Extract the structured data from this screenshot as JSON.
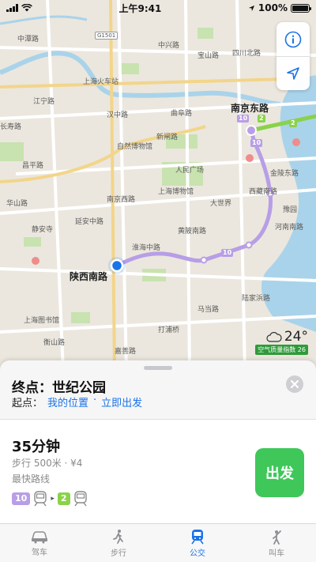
{
  "status_bar": {
    "time": "上午9:41",
    "battery": "100%"
  },
  "map": {
    "labels": {
      "zhongshan": "中潭路",
      "baoshan": "宝山路",
      "zhongxing": "中兴路",
      "sichuan": "四川北路",
      "shanghai_station": "上海火车站",
      "jiangning": "江宁路",
      "hanzhong": "汉中路",
      "qufu": "曲阜路",
      "changshou": "长寿路",
      "nanjing_east": "南京东路",
      "ziran": "自然博物馆",
      "xinzha": "新闸路",
      "changping": "昌平路",
      "people_square": "人民广场",
      "museum": "上海博物馆",
      "nanjing_west": "南京西路",
      "dashijie": "大世界",
      "yanan": "延安中路",
      "jingan": "静安寺",
      "huangpi": "黄陂南路",
      "huaihai": "淮海中路",
      "shaanxi_south": "陕西南路",
      "library": "上海图书馆",
      "madang": "马当路",
      "lujiabang": "陆家浜路",
      "hengshan": "衡山路",
      "dapu": "打浦桥",
      "jiashan": "嘉善路",
      "xizang": "西藏南路",
      "jinling": "金陵东路",
      "yu_garden": "豫园",
      "henan": "河南南路",
      "xinhua": "华山路",
      "south_shaanxi_hwy": "G1501"
    },
    "weather": {
      "temperature": "24°",
      "aqi_label": "空气质量指数 26"
    },
    "line_badges": {
      "line10": "10",
      "line2": "2"
    },
    "colors": {
      "line10": "#b89ee6",
      "line2": "#8ad24a",
      "water": "#a9d3ea",
      "park": "#c8e2b0",
      "road": "#ffffff",
      "location": "#1a73e8"
    }
  },
  "sheet": {
    "destination": "终点：世纪公园",
    "origin_label": "起点：",
    "origin_location": "我的位置",
    "origin_separator": "·",
    "origin_time": "立即出发"
  },
  "route": {
    "duration": "35分钟",
    "meta": "步行 500米 · ¥4",
    "tag": "最快路线",
    "line_a": "10",
    "line_b": "2",
    "go_label": "出发"
  },
  "tabs": [
    {
      "label": "驾车",
      "icon": "car-icon"
    },
    {
      "label": "步行",
      "icon": "walk-icon"
    },
    {
      "label": "公交",
      "icon": "transit-icon"
    },
    {
      "label": "叫车",
      "icon": "rideshare-icon"
    }
  ]
}
